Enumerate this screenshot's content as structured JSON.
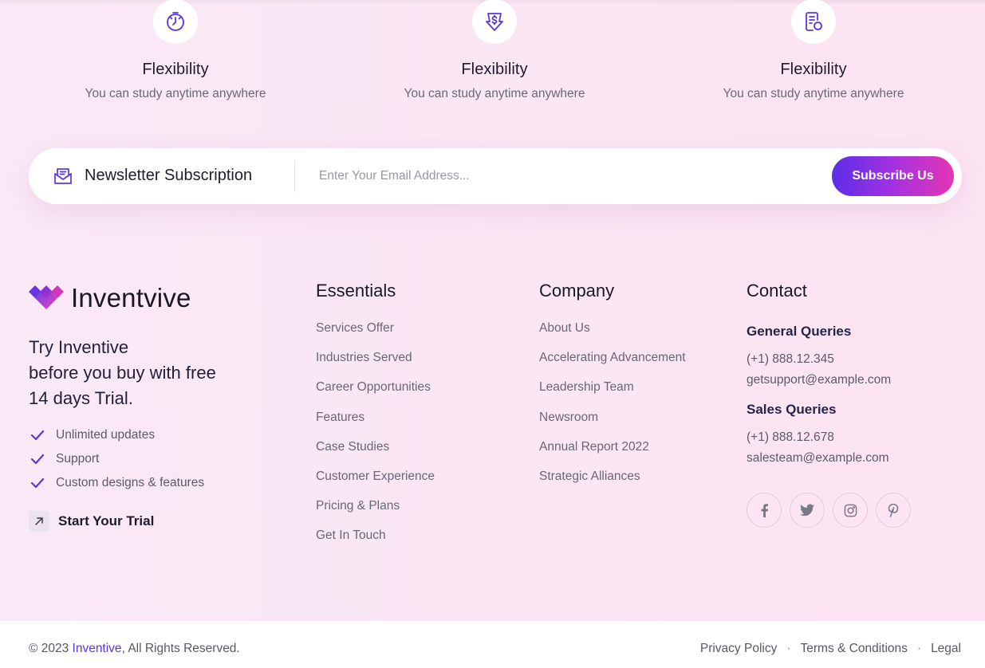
{
  "features": [
    {
      "icon": "clock-icon",
      "title": "Flexibility",
      "text": "You can study anytime anywhere"
    },
    {
      "icon": "price-drop-icon",
      "title": "Flexibility",
      "text": "You can study anytime anywhere"
    },
    {
      "icon": "document-search-icon",
      "title": "Flexibility",
      "text": "You can study anytime anywhere"
    }
  ],
  "newsletter": {
    "title": "Newsletter Subscription",
    "placeholder": "Enter Your Email Address...",
    "button": "Subscribe Us",
    "icon": "envelope-open-icon"
  },
  "brand": {
    "name": "Inventvive",
    "logo_icon": "diamond-logo-icon",
    "trial_lines": [
      "Try Inventive",
      "before you buy with free",
      "14 days Trial."
    ],
    "checks": [
      "Unlimited updates",
      "Support",
      "Custom designs & features"
    ],
    "trial_link": "Start Your Trial"
  },
  "essentials": {
    "title": "Essentials",
    "links": [
      "Services Offer",
      "Industries Served",
      "Career Opportunities",
      "Features",
      "Case Studies",
      "Customer Experience",
      "Pricing & Plans",
      "Get In Touch"
    ]
  },
  "company": {
    "title": "Company",
    "links": [
      "About Us",
      "Accelerating Advancement",
      "Leadership Team",
      "Newsroom",
      "Annual Report 2022",
      "Strategic Alliances"
    ]
  },
  "contact": {
    "title": "Contact",
    "general_title": "General Queries",
    "general_phone": "(+1) 888.12.345",
    "general_email": "getsupport@example.com",
    "sales_title": "Sales Queries",
    "sales_phone": "(+1) 888.12.678",
    "sales_email": "salesteam@example.com",
    "socials": [
      "facebook-icon",
      "twitter-icon",
      "instagram-icon",
      "pinterest-icon"
    ]
  },
  "footer": {
    "copyright_prefix": "© 2023 ",
    "copyright_brand": "Inventive",
    "copyright_suffix": ", All Rights Reserved.",
    "links": [
      "Privacy Policy",
      "Terms & Conditions",
      "Legal"
    ],
    "separator": "·"
  },
  "colors": {
    "accent": "#5a35e0",
    "gradient_start": "#5b2ee8",
    "gradient_end": "#e336b3",
    "background": "#fbe6f4"
  }
}
